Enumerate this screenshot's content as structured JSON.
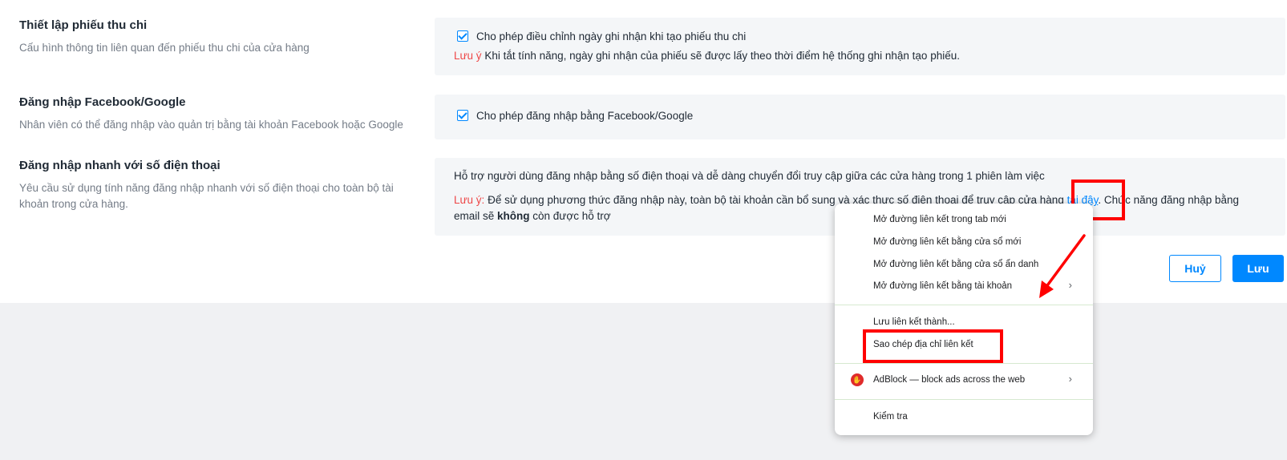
{
  "sections": [
    {
      "title": "Thiết lập phiếu thu chi",
      "desc": "Cấu hình thông tin liên quan đến phiếu thu chi của cửa hàng",
      "checkbox_label": "Cho phép điều chỉnh ngày ghi nhận khi tạo phiếu thu chi",
      "note_label": "Lưu ý",
      "note_text": " Khi tắt tính năng, ngày ghi nhận của phiếu sẽ được lấy theo thời điểm hệ thống ghi nhận tạo phiếu."
    },
    {
      "title": "Đăng nhập Facebook/Google",
      "desc": "Nhân viên có thể đăng nhập vào quản trị bằng tài khoản Facebook hoặc Google",
      "checkbox_label": "Cho phép đăng nhập bằng Facebook/Google"
    },
    {
      "title": "Đăng nhập nhanh với số điện thoại",
      "desc": "Yêu cầu sử dụng tính năng đăng nhập nhanh với số điện thoại cho toàn bộ tài khoản trong cửa hàng.",
      "intro": "Hỗ trợ người dùng đăng nhập bằng số điện thoại và dễ dàng chuyển đổi truy cập giữa các cửa hàng trong 1 phiên làm việc",
      "note_label": "Lưu ý:",
      "note_text": " Để sử dụng phương thức đăng nhập này, toàn bộ tài khoản cần bổ sung và xác thực số điện thoại để truy cập cửa hàng ",
      "link_text": "tại đây",
      "note_rest": ". Chức năng đăng nhập bằng",
      "line2_prefix": "email sẽ ",
      "line2_bold": "không",
      "line2_suffix": " còn được hỗ trợ"
    }
  ],
  "buttons": {
    "cancel": "Huỷ",
    "save": "Lưu"
  },
  "context_menu": {
    "items": [
      "Mở đường liên kết trong tab mới",
      "Mở đường liên kết bằng cửa sổ mới",
      "Mở đường liên kết bằng cửa sổ ẩn danh",
      "Mở đường liên kết bằng tài khoản",
      "Lưu liên kết thành...",
      "Sao chép địa chỉ liên kết",
      "AdBlock — block ads across the web",
      "Kiểm tra"
    ],
    "submenu_chevron": "›"
  },
  "colors": {
    "accent": "#0088ff",
    "note": "#ee4747",
    "highlight": "#ff0000"
  }
}
